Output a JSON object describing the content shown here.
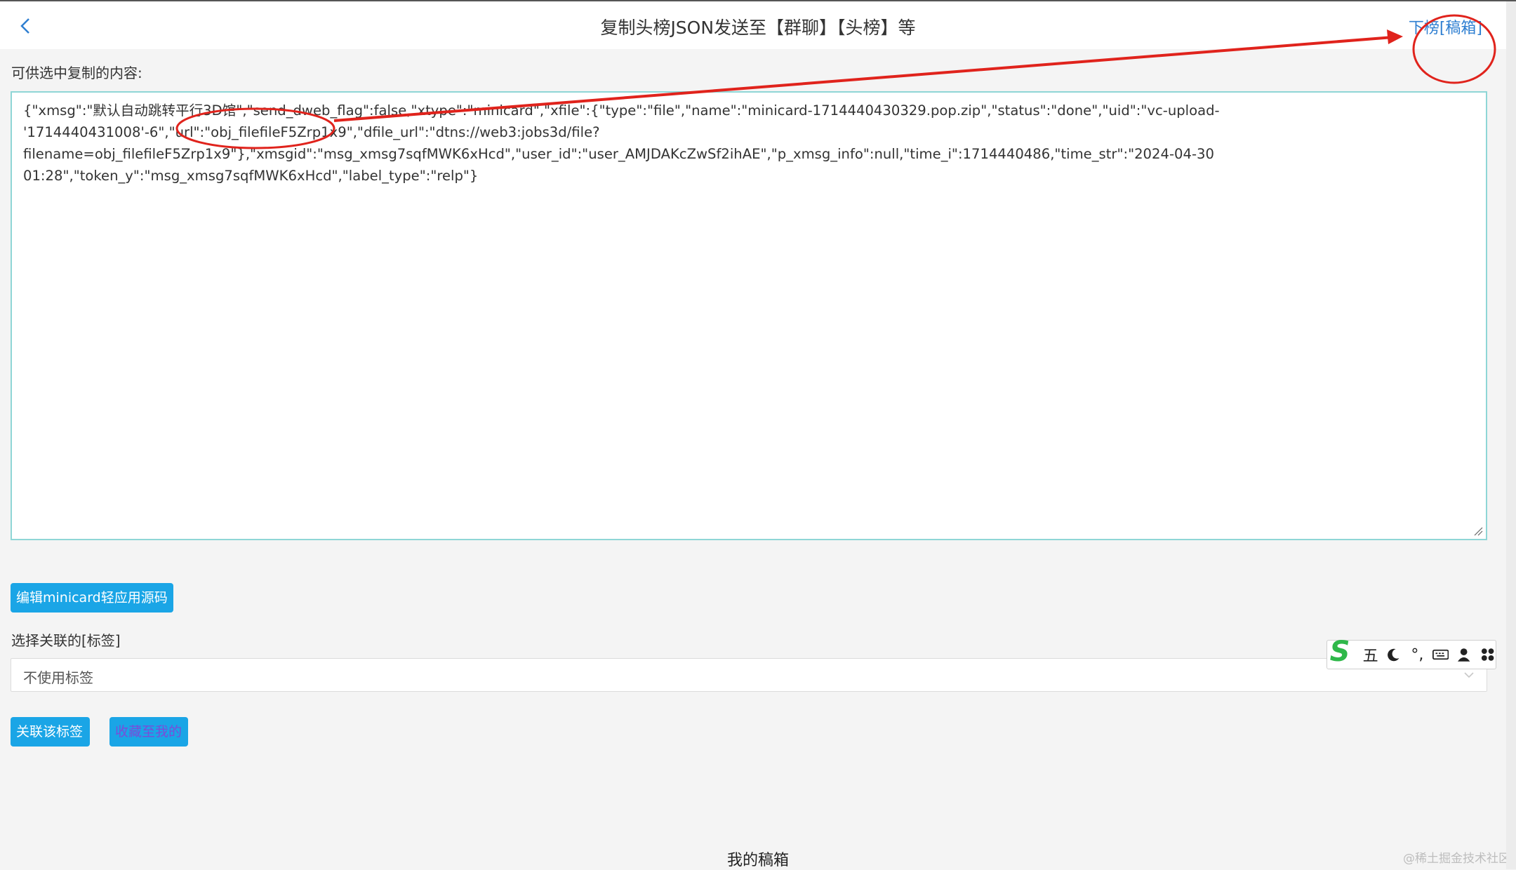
{
  "header": {
    "title": "复制头榜JSON发送至【群聊】【头榜】等",
    "right_link": "下榜[稿箱]"
  },
  "content": {
    "copy_label": "可供选中复制的内容:",
    "json_lines": [
      "{\"xmsg\":\"默认自动跳转平行3D馆\",\"send_dweb_flag\":false,\"xtype\":\"minicard\",\"xfile\":{\"type\":\"file\",\"name\":\"minicard-1714440430329.pop.zip\",\"status\":\"done\",\"uid\":\"vc-upload-",
      "'1714440431008'-6\",\"url\":\"obj_filefileF5Zrp1x9\",\"dfile_url\":\"dtns://web3:jobs3d/file?",
      "filename=obj_filefileF5Zrp1x9\"},\"xmsgid\":\"msg_xmsg7sqfMWK6xHcd\",\"user_id\":\"user_AMJDAKcZwSf2ihAE\",\"p_xmsg_info\":null,\"time_i\":1714440486,\"time_str\":\"2024-04-30",
      "01:28\",\"token_y\":\"msg_xmsg7sqfMWK6xHcd\",\"label_type\":\"relp\"}"
    ]
  },
  "actions": {
    "edit_button": "编辑minicard轻应用源码",
    "tag_label": "选择关联的[标签]",
    "tag_select_value": "不使用标签",
    "associate_button": "关联该标签",
    "favorite_button": "收藏至我的"
  },
  "ime": {
    "mode_label": "五",
    "punct_label": "°,",
    "icons": [
      "moon-icon",
      "keyboard-icon",
      "user-icon",
      "grid-icon"
    ]
  },
  "footer": {
    "title": "我的稿箱",
    "watermark": "@稀土掘金技术社区"
  },
  "colors": {
    "accent_button": "#1aa5e6",
    "link": "#2f7fd1",
    "annotation_red": "#e0231c",
    "textarea_border": "#8fd6d6"
  }
}
